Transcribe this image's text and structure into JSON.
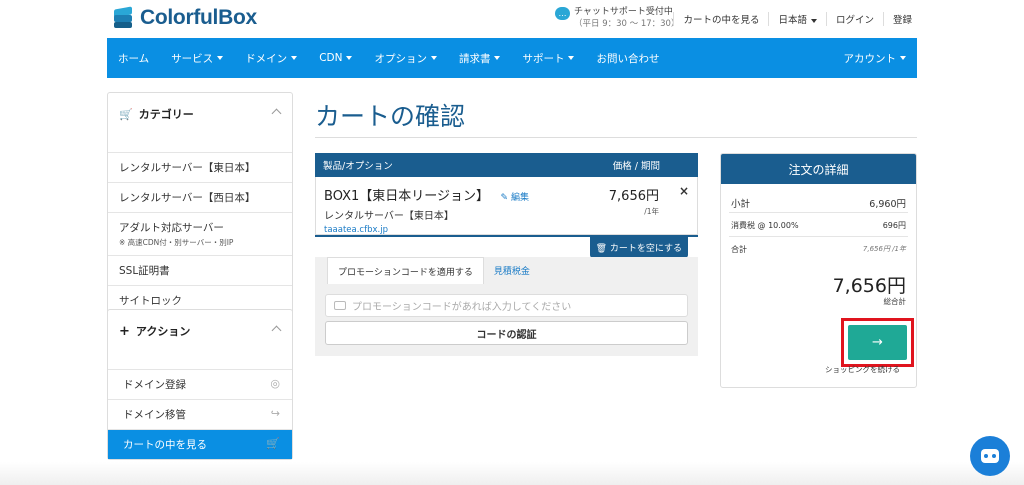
{
  "brand": {
    "name": "ColorfulBox"
  },
  "header": {
    "support_title": "チャットサポート受付中",
    "support_hours": "（平日 9：30 〜 17：30）",
    "links": [
      "カートの中を見る",
      "日本語",
      "ログイン",
      "登録"
    ]
  },
  "nav": {
    "items": [
      "ホーム",
      "サービス",
      "ドメイン",
      "CDN",
      "オプション",
      "請求書",
      "サポート",
      "お問い合わせ"
    ],
    "account": "アカウント"
  },
  "sidebar": {
    "categories": {
      "title": "カテゴリー",
      "items": [
        {
          "label": "レンタルサーバー【東日本】"
        },
        {
          "label": "レンタルサーバー【西日本】"
        },
        {
          "label": "アダルト対応サーバー",
          "sub": "※ 高速CDN付・別サーバー・別IP"
        },
        {
          "label": "SSL証明書"
        },
        {
          "label": "サイトロック"
        }
      ]
    },
    "actions": {
      "title": "アクション",
      "items": [
        {
          "label": "ドメイン登録"
        },
        {
          "label": "ドメイン移管"
        },
        {
          "label": "カートの中を見る"
        }
      ]
    }
  },
  "main": {
    "title": "カートの確認",
    "cart": {
      "col_product": "製品/オプション",
      "col_price": "価格 / 期間",
      "item": {
        "name": "BOX1【東日本リージョン】",
        "edit": "編集",
        "group": "レンタルサーバー【東日本】",
        "domain": "taaatea.cfbx.jp",
        "price": "7,656円",
        "cycle": "/1年"
      },
      "empty_cart": "カートを空にする"
    },
    "promo": {
      "tab_promo": "プロモーションコードを適用する",
      "tab_estimate": "見積税金",
      "placeholder": "プロモーションコードがあれば入力してください",
      "validate": "コードの認証"
    }
  },
  "summary": {
    "title": "注文の詳細",
    "subtotal_label": "小計",
    "subtotal": "6,960円",
    "tax_label": "消費税 @ 10.00%",
    "tax": "696円",
    "total_label": "合計",
    "total_cycle": "7,656円 /1年",
    "total": "7,656円",
    "total_caption": "総合計",
    "checkout_glyph": "→",
    "continue": "ショッピングを続ける"
  }
}
